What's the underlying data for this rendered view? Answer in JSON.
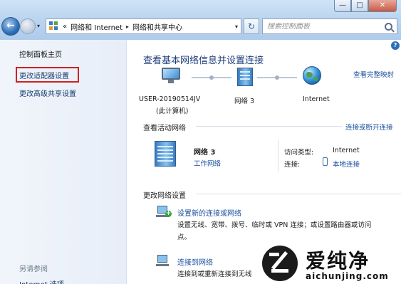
{
  "window": {
    "min_glyph": "—",
    "max_glyph": "□",
    "close_glyph": "✕"
  },
  "nav": {
    "back_glyph": "←",
    "forward_glyph": "→",
    "dropdown_glyph": "▾",
    "breadcrumb_overflow": "«",
    "breadcrumbs": [
      "网络和 Internet",
      "网络和共享中心"
    ],
    "crumb_separator": "▸",
    "refresh_glyph": "↻",
    "search_placeholder": "搜索控制面板"
  },
  "sidebar": {
    "home": "控制面板主页",
    "items": [
      {
        "label": "更改适配器设置",
        "highlighted": true,
        "highlight_color": "#d41f1f"
      },
      {
        "label": "更改高级共享设置"
      }
    ],
    "see_also": "另请参阅",
    "see_also_items": [
      "Internet 选项"
    ]
  },
  "main": {
    "help_glyph": "?",
    "title": "查看基本网络信息并设置连接",
    "full_map_link": "查看完整映射",
    "network_map": {
      "computer_name": "USER-20190514JV",
      "computer_note": "(此计算机)",
      "network_name": "网络  3",
      "internet_label": "Internet"
    },
    "active_networks": {
      "heading": "查看活动网络",
      "connect_link": "连接或断开连接",
      "network_name": "网络  3",
      "network_type": "工作网络",
      "access_type_label": "访问类型:",
      "access_type_value": "Internet",
      "connections_label": "连接:",
      "connections_value": "本地连接"
    },
    "change_settings": {
      "heading": "更改网络设置",
      "tasks": [
        {
          "link": "设置新的连接或网络",
          "description": [
            "设置无线、宽带、拨号、临时或 VPN 连接；或设置路由器或访问",
            "点。"
          ]
        },
        {
          "link": "连接到网络",
          "description": [
            "连接到或重新连接到无线"
          ]
        }
      ]
    }
  },
  "watermark": {
    "brand_cn": "爱纯净",
    "brand_url": "aichunjing.com"
  }
}
